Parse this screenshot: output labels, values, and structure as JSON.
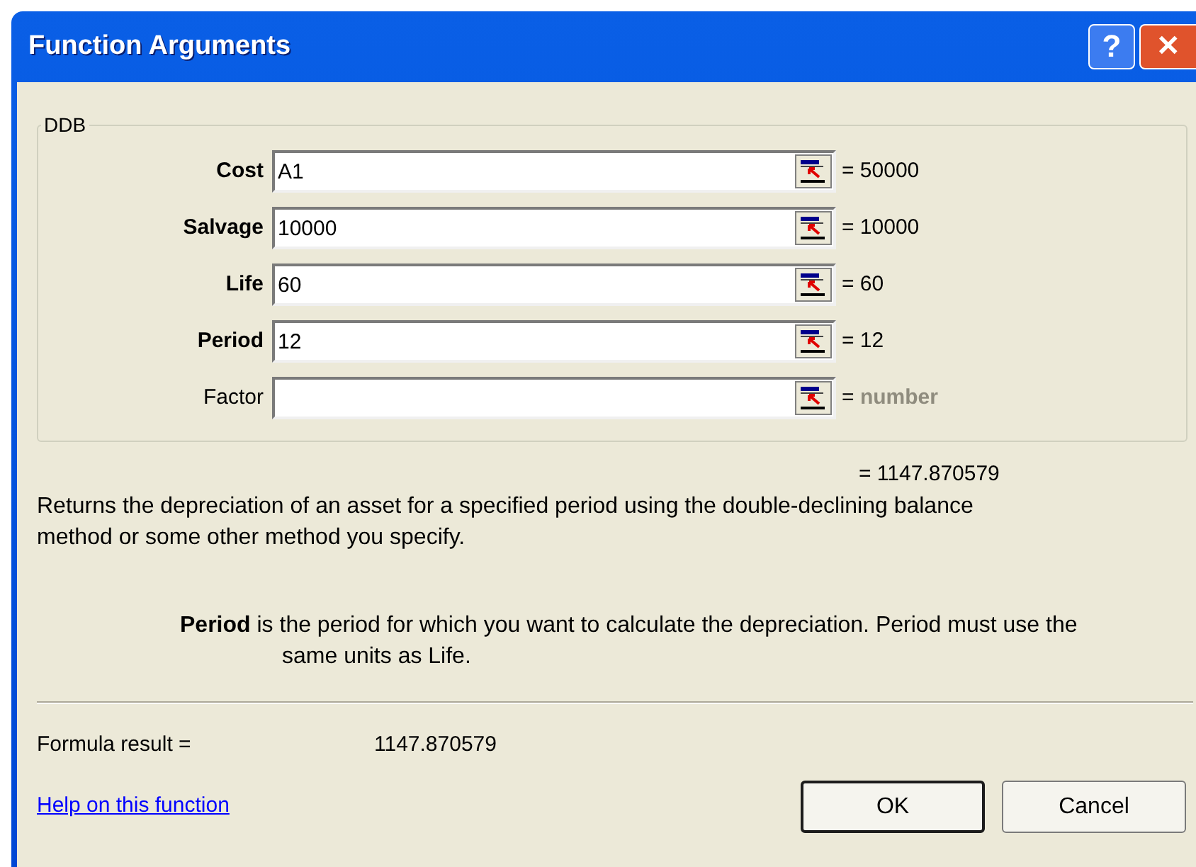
{
  "window": {
    "title": "Function Arguments",
    "help_button": "?",
    "close_button": "✕"
  },
  "group": {
    "title": "DDB",
    "arguments": [
      {
        "label": "Cost",
        "required": true,
        "value": "A1",
        "result": "= 50000"
      },
      {
        "label": "Salvage",
        "required": true,
        "value": "10000",
        "result": "= 10000"
      },
      {
        "label": "Life",
        "required": true,
        "value": "60",
        "result": "= 60"
      },
      {
        "label": "Period",
        "required": true,
        "value": "12",
        "result": "= 12"
      },
      {
        "label": "Factor",
        "required": false,
        "result": "= ",
        "dimmed_text": "number"
      }
    ]
  },
  "function_result": "= 1147.870579",
  "description": "Returns the depreciation of an asset for a specified period using the double-declining balance method or some other method you specify.",
  "argument_help": "**Period** is the period for which you want to calculate the depreciation. Period must use the same units as Life.",
  "formula_result": {
    "label": "Formula result =",
    "value": "1147.870579"
  },
  "help_link": "Help on this function",
  "buttons": [
    {
      "label": "OK",
      "default": true
    },
    {
      "label": "Cancel",
      "default": false
    }
  ]
}
